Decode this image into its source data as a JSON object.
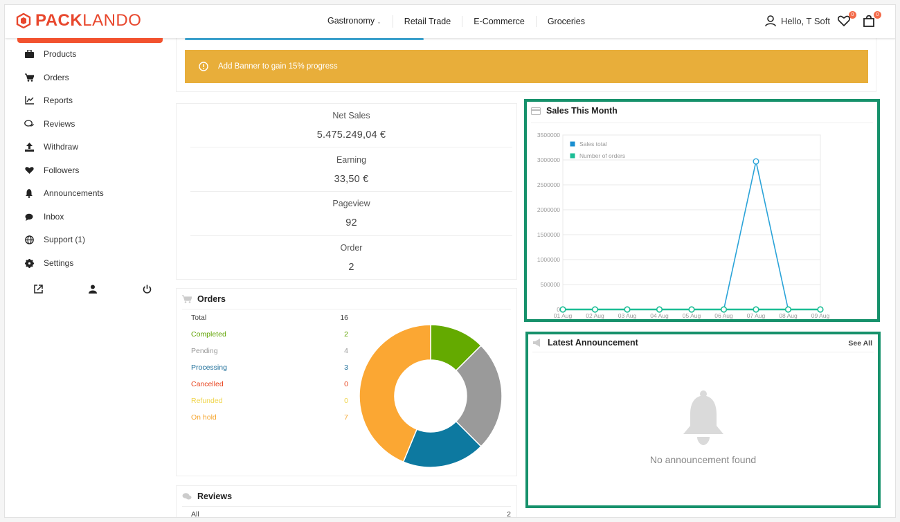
{
  "brand": {
    "part1": "PACK",
    "part2": "LANDO"
  },
  "nav": {
    "items": [
      "Gastronomy",
      "Retail Trade",
      "E-Commerce",
      "Groceries"
    ]
  },
  "user": {
    "greeting": "Hello, T Soft",
    "wishlist_count": "0",
    "cart_count": "0"
  },
  "sidebar": {
    "items": [
      {
        "label": "Products",
        "icon": "briefcase-icon"
      },
      {
        "label": "Orders",
        "icon": "cart-icon"
      },
      {
        "label": "Reports",
        "icon": "chart-icon"
      },
      {
        "label": "Reviews",
        "icon": "comments-icon"
      },
      {
        "label": "Withdraw",
        "icon": "upload-icon"
      },
      {
        "label": "Followers",
        "icon": "heart-icon"
      },
      {
        "label": "Announcements",
        "icon": "bell-icon"
      },
      {
        "label": "Inbox",
        "icon": "chat-icon"
      },
      {
        "label": "Support (1)",
        "icon": "globe-icon"
      },
      {
        "label": "Settings",
        "icon": "gear-icon"
      }
    ]
  },
  "banner": {
    "text": "Add Banner to gain 15% progress"
  },
  "stats": {
    "items": [
      {
        "label": "Net Sales",
        "value": "5.475.249,04 €"
      },
      {
        "label": "Earning",
        "value": "33,50 €"
      },
      {
        "label": "Pageview",
        "value": "92"
      },
      {
        "label": "Order",
        "value": "2"
      }
    ]
  },
  "orders": {
    "title": "Orders",
    "rows": [
      {
        "label": "Total",
        "value": "16",
        "color": "#444444"
      },
      {
        "label": "Completed",
        "value": "2",
        "color": "#5fa300"
      },
      {
        "label": "Pending",
        "value": "4",
        "color": "#999999"
      },
      {
        "label": "Processing",
        "value": "3",
        "color": "#1d6e99"
      },
      {
        "label": "Cancelled",
        "value": "0",
        "color": "#e8441f"
      },
      {
        "label": "Refunded",
        "value": "0",
        "color": "#f0d54b"
      },
      {
        "label": "On hold",
        "value": "7",
        "color": "#f5a630"
      }
    ],
    "donut": [
      {
        "name": "Completed",
        "value": 2,
        "color": "#64aa00"
      },
      {
        "name": "Pending",
        "value": 4,
        "color": "#9a9a9a"
      },
      {
        "name": "Processing",
        "value": 3,
        "color": "#0d79a0"
      },
      {
        "name": "On hold",
        "value": 7,
        "color": "#fba733"
      }
    ]
  },
  "reviews": {
    "title": "Reviews",
    "all_label": "All",
    "all_value": "2"
  },
  "sales": {
    "title": "Sales This Month",
    "legend": [
      {
        "name": "Sales total",
        "color": "#1a8fd1"
      },
      {
        "name": "Number of orders",
        "color": "#1bbd95"
      }
    ]
  },
  "chart_data": {
    "type": "line",
    "title": "Sales This Month",
    "x": [
      "01 Aug",
      "02 Aug",
      "03 Aug",
      "04 Aug",
      "05 Aug",
      "06 Aug",
      "07 Aug",
      "08 Aug",
      "09 Aug"
    ],
    "y_ticks": [
      "3500000",
      "3000000",
      "2500000",
      "2000000",
      "1500000",
      "1000000",
      "500000",
      "0"
    ],
    "ylim": [
      0,
      3500000
    ],
    "series": [
      {
        "name": "Sales total",
        "values": [
          0,
          0,
          0,
          0,
          0,
          0,
          2970000,
          0,
          0
        ],
        "color": "#2aa3d8"
      },
      {
        "name": "Number of orders",
        "values": [
          0,
          0,
          0,
          0,
          0,
          0,
          2,
          0,
          0
        ],
        "color": "#1bbd95"
      }
    ],
    "grid": true,
    "legend": "top-left"
  },
  "announce": {
    "title": "Latest Announcement",
    "see_all": "See All",
    "empty": "No announcement found"
  }
}
